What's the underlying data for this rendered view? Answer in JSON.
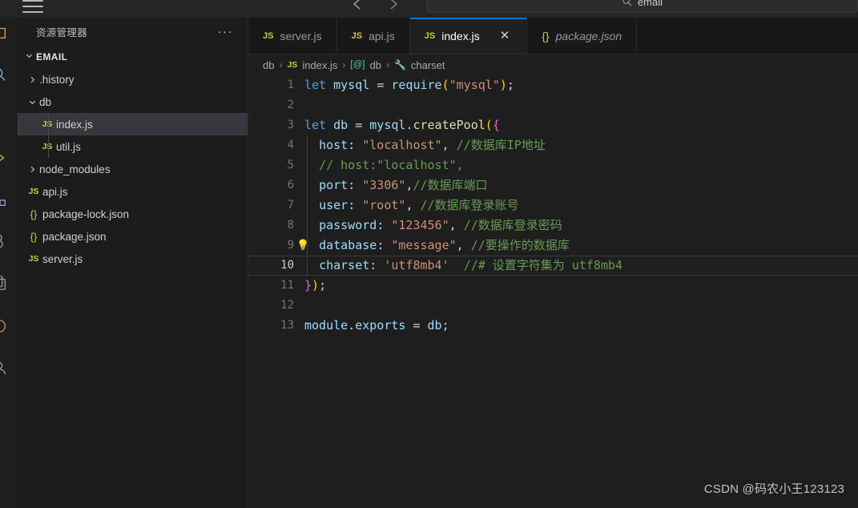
{
  "titlebar": {
    "menu_icon": "hamburger-icon",
    "back_icon": "arrow-back-icon",
    "forward_icon": "arrow-forward-icon",
    "search_icon": "search-icon",
    "search_value": "email"
  },
  "sidebar": {
    "title": "资源管理器",
    "more_actions": "···",
    "root": {
      "label": "EMAIL",
      "expanded": true
    },
    "items": [
      {
        "label": ".history",
        "kind": "folder",
        "expanded": false,
        "indent": 1,
        "selected": false
      },
      {
        "label": "db",
        "kind": "folder",
        "expanded": true,
        "indent": 1,
        "selected": false
      },
      {
        "label": "index.js",
        "kind": "js",
        "indent": 2,
        "selected": true
      },
      {
        "label": "util.js",
        "kind": "js",
        "indent": 2,
        "selected": false
      },
      {
        "label": "node_modules",
        "kind": "folder",
        "expanded": false,
        "indent": 1,
        "selected": false
      },
      {
        "label": "api.js",
        "kind": "js",
        "indent": 1,
        "selected": false
      },
      {
        "label": "package-lock.json",
        "kind": "json",
        "indent": 1,
        "selected": false
      },
      {
        "label": "package.json",
        "kind": "json",
        "indent": 1,
        "selected": false
      },
      {
        "label": "server.js",
        "kind": "js",
        "indent": 1,
        "selected": false
      }
    ]
  },
  "editor": {
    "tabs": [
      {
        "label": "server.js",
        "icon": "js",
        "active": false,
        "italic": false,
        "closable": false
      },
      {
        "label": "api.js",
        "icon": "js",
        "active": false,
        "italic": false,
        "closable": false
      },
      {
        "label": "index.js",
        "icon": "js",
        "active": true,
        "italic": false,
        "closable": true,
        "close_glyph": "✕"
      },
      {
        "label": "package.json",
        "icon": "json",
        "active": false,
        "italic": true,
        "closable": false
      }
    ],
    "breadcrumb": [
      {
        "label": "db",
        "icon": ""
      },
      {
        "label": "index.js",
        "icon": "js"
      },
      {
        "label": "db",
        "icon": "symbol-object"
      },
      {
        "label": "charset",
        "icon": "wrench"
      }
    ],
    "breadcrumb_separator": "›",
    "current_line": 10,
    "lightbulb_line": 9,
    "lightbulb_glyph": "💡",
    "lines": [
      {
        "n": 1,
        "text": "let mysql = require(\"mysql\");"
      },
      {
        "n": 2,
        "text": ""
      },
      {
        "n": 3,
        "text": "let db = mysql.createPool({"
      },
      {
        "n": 4,
        "text": "  host: \"localhost\", //数据库IP地址"
      },
      {
        "n": 5,
        "text": "  // host:\"localhost\","
      },
      {
        "n": 6,
        "text": "  port: \"3306\",//数据库端口"
      },
      {
        "n": 7,
        "text": "  user: \"root\", //数据库登录账号"
      },
      {
        "n": 8,
        "text": "  password: \"123456\", //数据库登录密码"
      },
      {
        "n": 9,
        "text": "  database: \"message\", //要操作的数据库"
      },
      {
        "n": 10,
        "text": "  charset: 'utf8mb4'  //# 设置字符集为 utf8mb4"
      },
      {
        "n": 11,
        "text": "});"
      },
      {
        "n": 12,
        "text": ""
      },
      {
        "n": 13,
        "text": "module.exports = db;"
      }
    ]
  },
  "watermark": "CSDN @码农小王123123",
  "colors": {
    "accent": "#0078d4",
    "editor_bg": "#1e1e1e",
    "sidebar_bg": "#1c1c1c",
    "tabbar_bg": "#181818",
    "selection_bg": "#37373d",
    "js_icon": "#cbcb41",
    "keyword": "#569cd6",
    "string": "#ce9178",
    "comment": "#6a9955",
    "property": "#9cdcfe",
    "function": "#dcdcaa",
    "number": "#b5cea8"
  }
}
